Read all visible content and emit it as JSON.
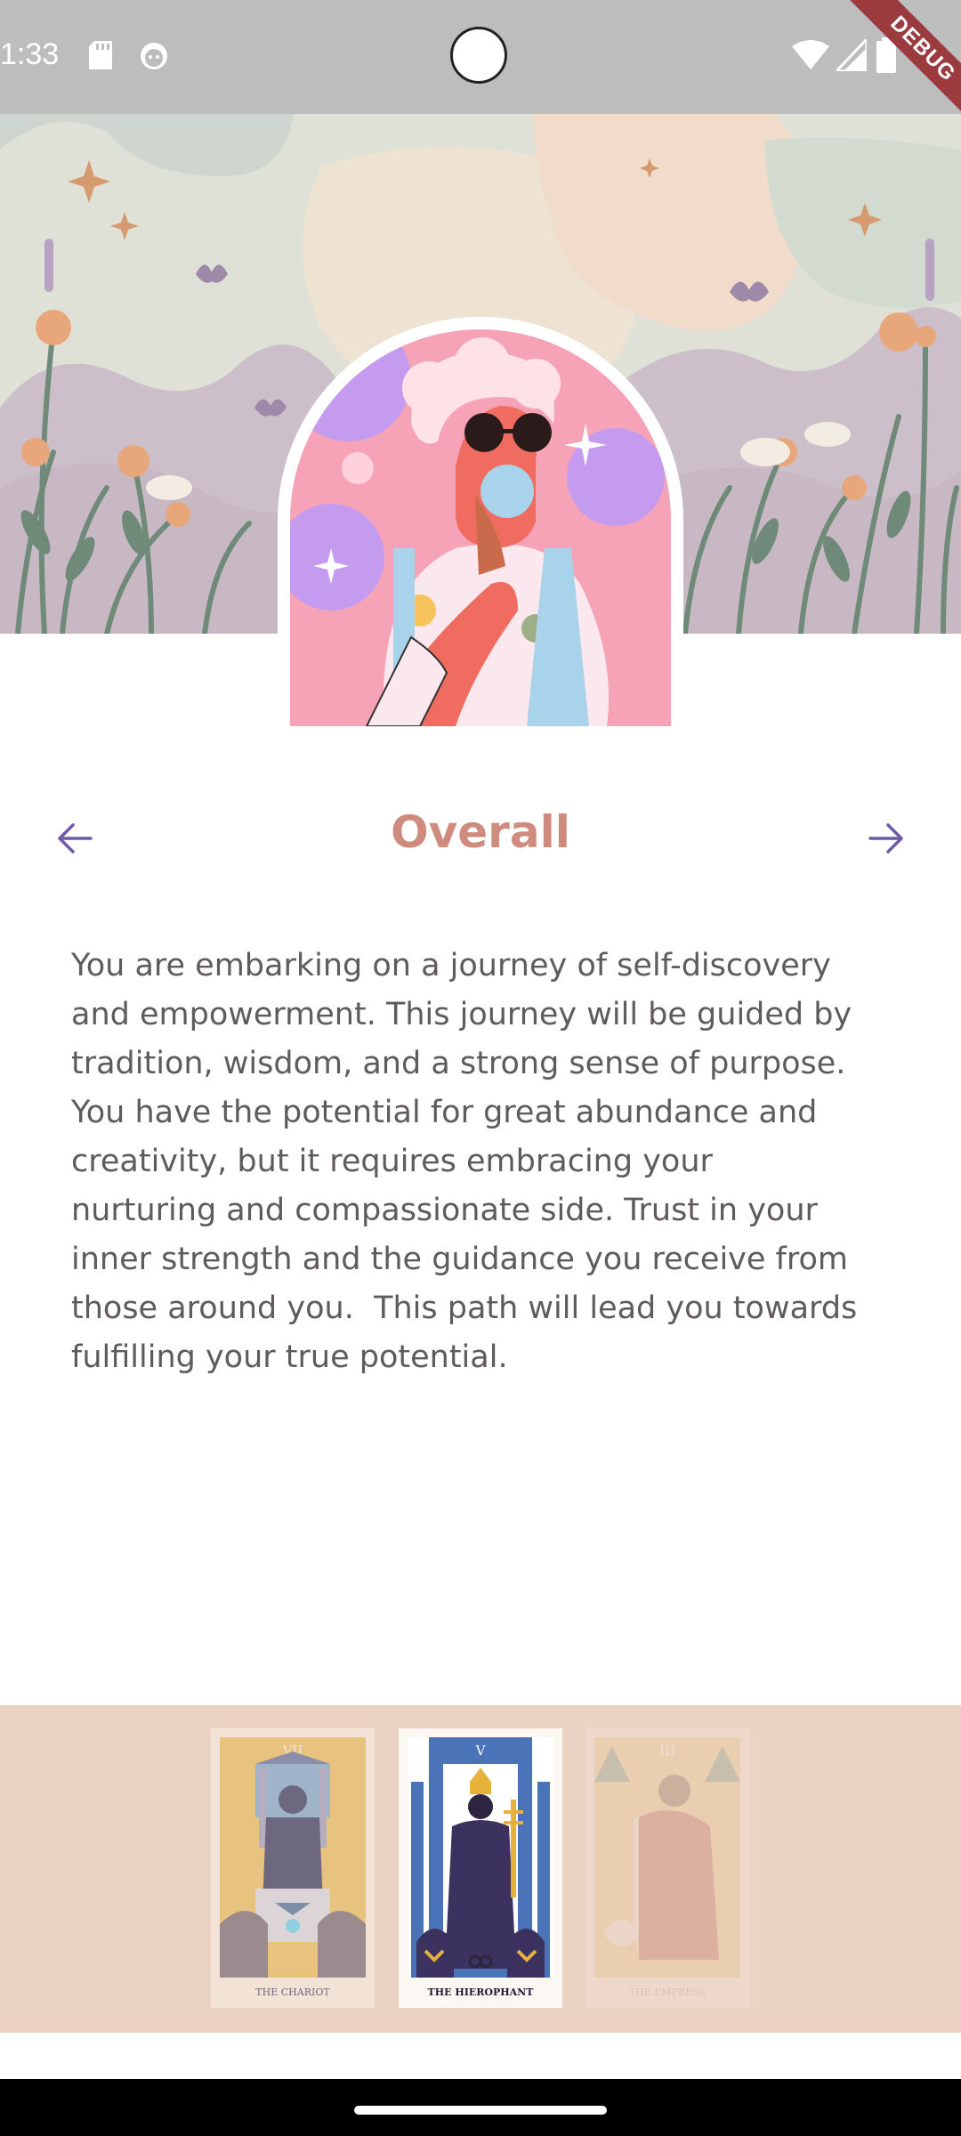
{
  "status_bar": {
    "time": "1:33",
    "debug_label": "DEBUG"
  },
  "reading": {
    "title": "Overall",
    "body": "You are embarking on a journey of self-discovery\nand empowerment. This journey will be guided by\ntradition, wisdom, and a strong sense of purpose.\nYou have the potential for great abundance and\ncreativity, but it requires embracing your\nnurturing and compassionate side. Trust in your\ninner strength and the guidance you receive from\nthose around you.  This path will lead you towards\nfulfilling your true potential."
  },
  "navigation": {
    "prev_icon": "arrow-left-icon",
    "next_icon": "arrow-right-icon"
  },
  "cards": [
    {
      "numeral": "VII",
      "name": "THE CHARIOT",
      "state": "dimmed"
    },
    {
      "numeral": "V",
      "name": "THE HIEROPHANT",
      "state": "active"
    },
    {
      "numeral": "III",
      "name": "THE EMPRESS",
      "state": "faded"
    }
  ],
  "colors": {
    "accent_title": "#d08b7f",
    "arrow": "#6f5aa8",
    "tray_background": "#ebd3c4",
    "body_text": "#5f5a5d"
  }
}
